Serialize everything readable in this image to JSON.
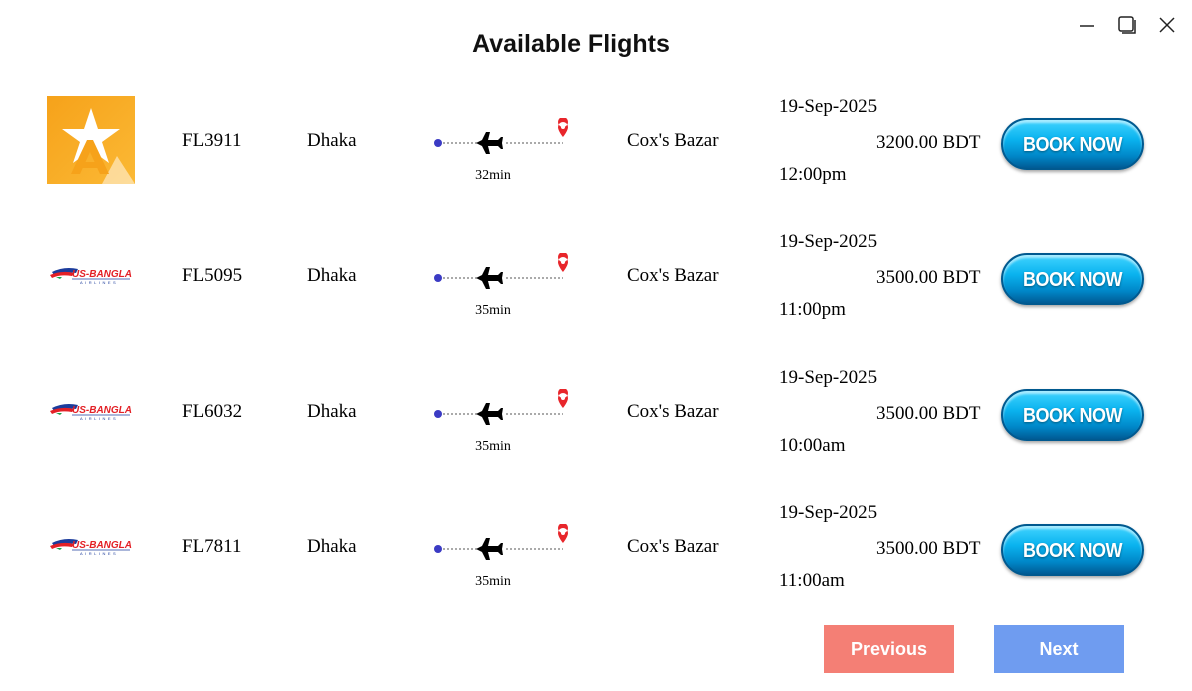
{
  "window": {
    "controls": [
      "minimize-icon",
      "maximize-icon",
      "close-icon"
    ]
  },
  "title": "Available Flights",
  "flights": [
    {
      "airline_logo": "star-a-logo",
      "code": "FL3911",
      "origin": "Dhaka",
      "duration": "32min",
      "destination": "Cox's Bazar",
      "date": "19-Sep-2025",
      "price": "3200.00 BDT",
      "time": "12:00pm",
      "book_label": "BOOK NOW"
    },
    {
      "airline_logo": "us-bangla-logo",
      "code": "FL5095",
      "origin": "Dhaka",
      "duration": "35min",
      "destination": "Cox's Bazar",
      "date": "19-Sep-2025",
      "price": "3500.00 BDT",
      "time": "11:00pm",
      "book_label": "BOOK NOW"
    },
    {
      "airline_logo": "us-bangla-logo",
      "code": "FL6032",
      "origin": "Dhaka",
      "duration": "35min",
      "destination": "Cox's Bazar",
      "date": "19-Sep-2025",
      "price": "3500.00 BDT",
      "time": "10:00am",
      "book_label": "BOOK NOW"
    },
    {
      "airline_logo": "us-bangla-logo",
      "code": "FL7811",
      "origin": "Dhaka",
      "duration": "35min",
      "destination": "Cox's Bazar",
      "date": "19-Sep-2025",
      "price": "3500.00 BDT",
      "time": "11:00am",
      "book_label": "BOOK NOW"
    }
  ],
  "pagination": {
    "previous_label": "Previous",
    "next_label": "Next"
  },
  "colors": {
    "previous": "#f47f75",
    "next": "#6f9cf0",
    "book_button": "#0ab3ef",
    "origin_dot": "#3b3bc4",
    "destination_pin": "#e8262b"
  }
}
